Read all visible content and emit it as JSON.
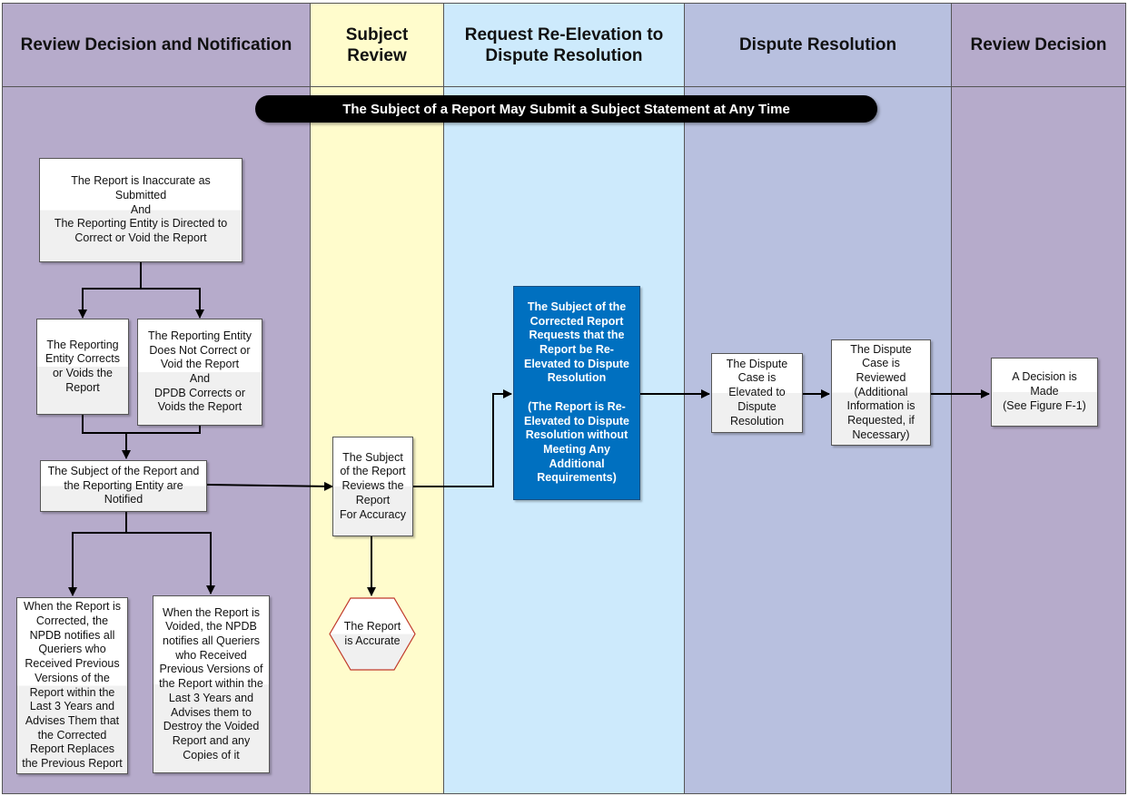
{
  "lanes": [
    {
      "id": "review-decision-notification",
      "title": "Review Decision and Notification",
      "color": "#b6abcb"
    },
    {
      "id": "subject-review",
      "title": "Subject\nReview",
      "color": "#fffccc"
    },
    {
      "id": "request-re-elevation",
      "title": "Request Re-Elevation to\nDispute Resolution",
      "color": "#cdeafc"
    },
    {
      "id": "dispute-resolution",
      "title": "Dispute Resolution",
      "color": "#b8c0df"
    },
    {
      "id": "review-decision",
      "title": "Review Decision",
      "color": "#b6abcb"
    }
  ],
  "banner": {
    "text": "The Subject of a Report May Submit a Subject Statement at Any Time"
  },
  "nodes": {
    "inaccurate": "The Report is Inaccurate as\nSubmitted\nAnd\nThe Reporting Entity is Directed to\nCorrect or Void the Report",
    "entity_corrects": "The Reporting\nEntity Corrects\nor Voids the\nReport",
    "entity_does_not_correct": "The Reporting Entity\nDoes Not Correct or\nVoid the Report\nAnd\nDPDB Corrects or\nVoids the Report",
    "notified": "The Subject of the Report and\nthe Reporting Entity are\nNotified",
    "corrected_notice": "When the Report is\nCorrected, the\nNPDB notifies all\nQueriers who\nReceived Previous\nVersions of the\nReport within the\nLast 3 Years and\nAdvises Them that\nthe Corrected\nReport Replaces\nthe Previous Report",
    "voided_notice": "When the Report is\nVoided, the NPDB\nnotifies all Queriers\nwho Received\nPrevious Versions of\nthe Report within the\nLast 3 Years and\nAdvises them to\nDestroy the Voided\nReport and any\nCopies of it",
    "subject_reviews": "The Subject\nof the Report\nReviews the\nReport\nFor Accuracy",
    "report_accurate": "The Report\nis Accurate",
    "request_re_elevation": "The Subject of the\nCorrected Report\nRequests that the\nReport be Re-\nElevated to Dispute\nResolution\n\n(The Report is Re-\nElevated to Dispute\nResolution without\nMeeting Any\nAdditional\nRequirements)",
    "elevated": "The Dispute\nCase is\nElevated to\nDispute\nResolution",
    "reviewed": "The Dispute\nCase is\nReviewed\n(Additional\nInformation is\nRequested, if\nNecessary)",
    "decision": "A Decision is\nMade\n(See Figure F-1)"
  }
}
